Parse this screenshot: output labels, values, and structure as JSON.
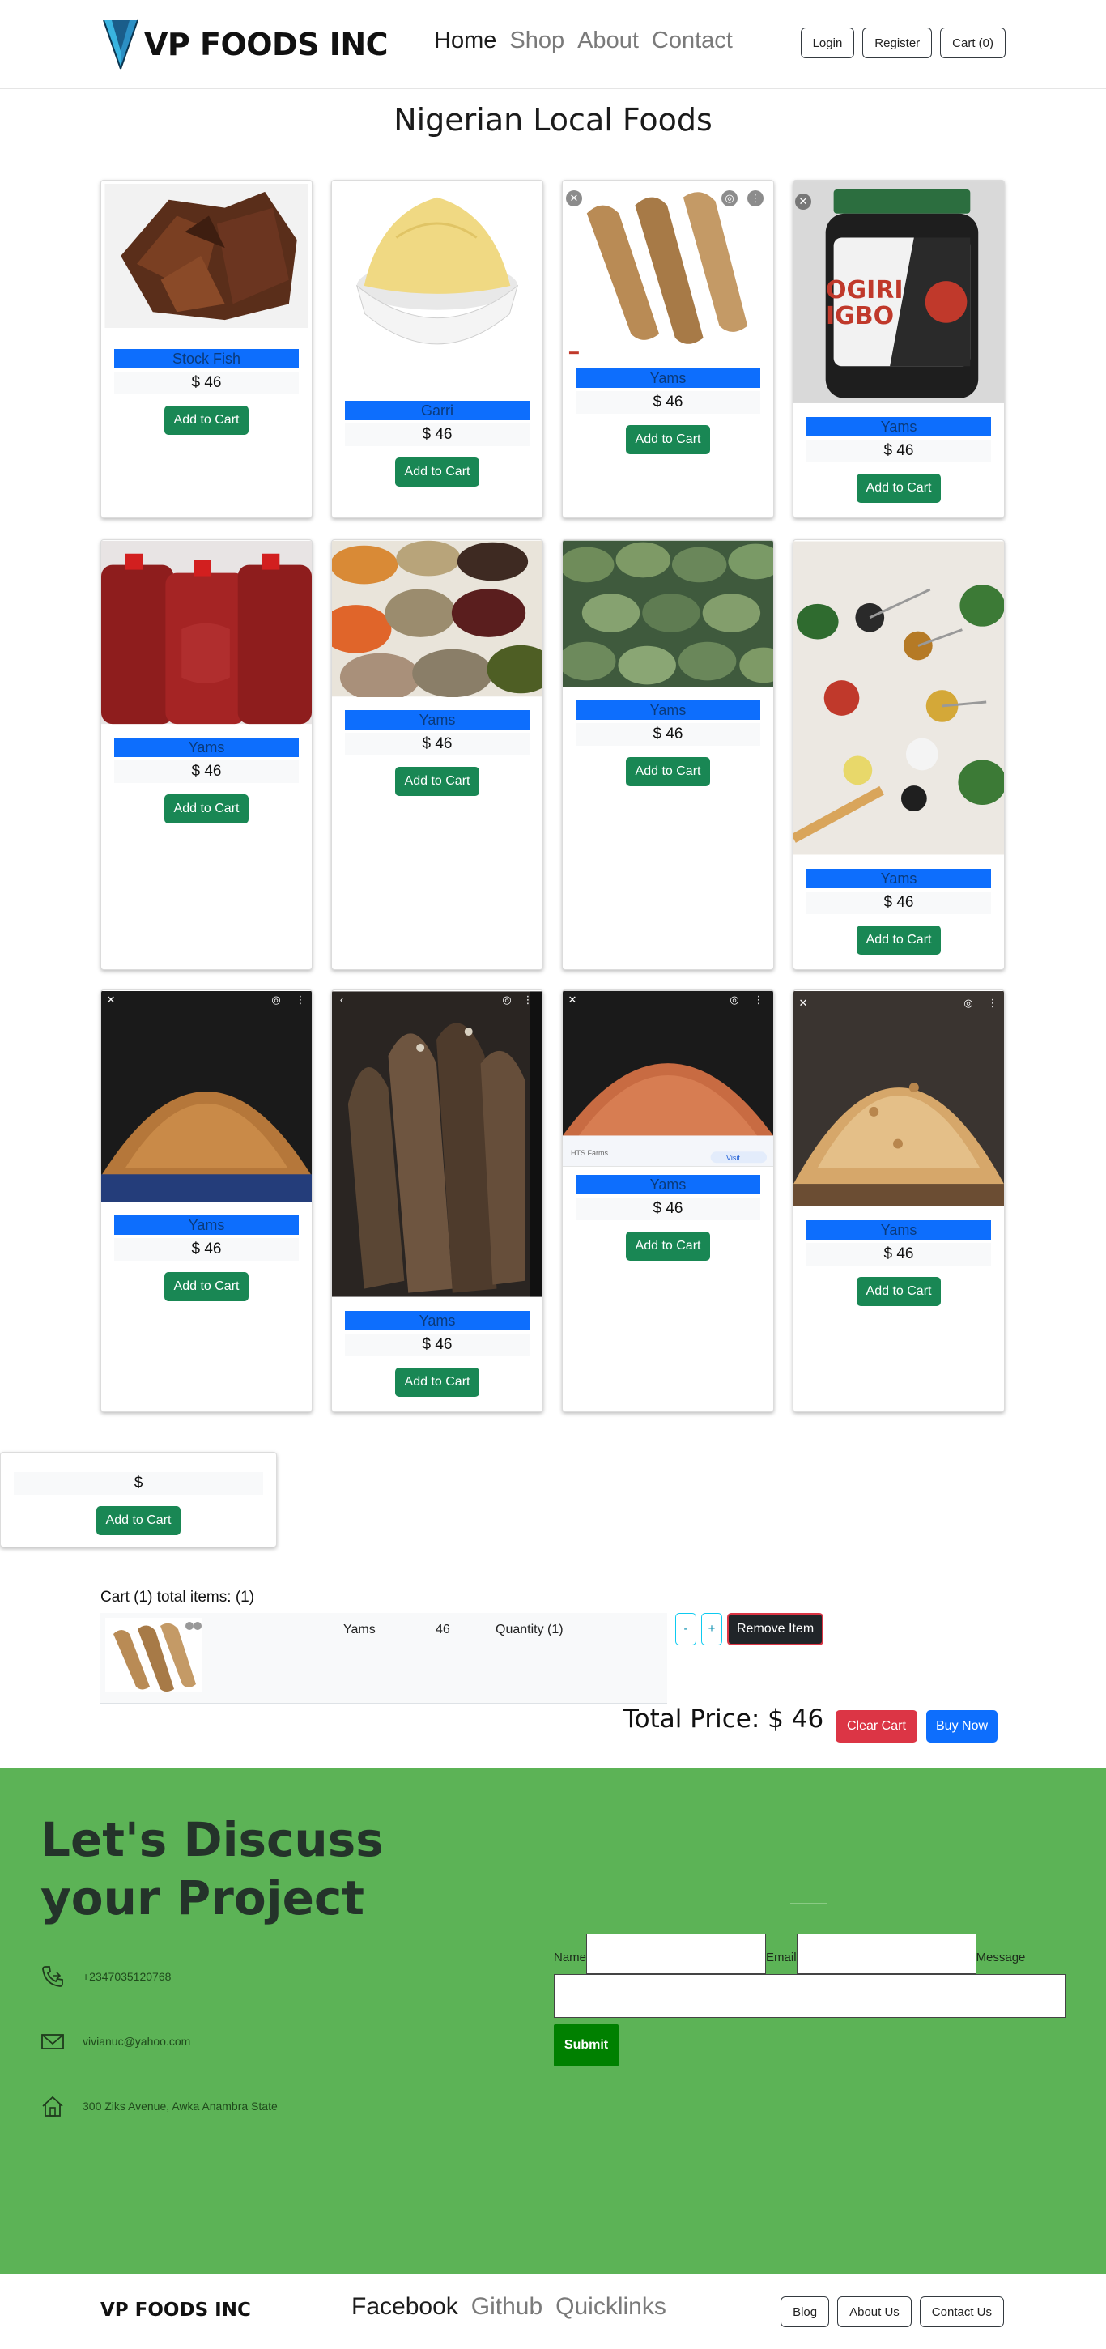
{
  "navbar": {
    "brand": "VP FOODS INC",
    "links": [
      "Home",
      "Shop",
      "About",
      "Contact"
    ],
    "actions": [
      "Login",
      "Register",
      "Cart (0)"
    ]
  },
  "page_title": "Nigerian Local Foods",
  "add_to_cart_label": "Add to Cart",
  "products": [
    {
      "name": "Stock Fish",
      "price": "$ 46",
      "image": "dried-fish-pile"
    },
    {
      "name": "Garri",
      "price": "$ 46",
      "image": "garri-bowl"
    },
    {
      "name": "Yams",
      "price": "$ 46",
      "image": "yam-tubers"
    },
    {
      "name": "Yams",
      "price": "$ 46",
      "image": "ogiri-igbo-jar"
    },
    {
      "name": "Yams",
      "price": "$ 46",
      "image": "palm-oil-gallons"
    },
    {
      "name": "Yams",
      "price": "$ 46",
      "image": "grain-sacks"
    },
    {
      "name": "Yams",
      "price": "$ 46",
      "image": "green-plantains"
    },
    {
      "name": "Yams",
      "price": "$ 46",
      "image": "spice-spoons"
    },
    {
      "name": "Yams",
      "price": "$ 46",
      "image": "grain-heap"
    },
    {
      "name": "Yams",
      "price": "$ 46",
      "image": "dried-catfish"
    },
    {
      "name": "Yams",
      "price": "$ 46",
      "image": "grain-heap-red"
    },
    {
      "name": "Yams",
      "price": "$ 46",
      "image": "nut-basket"
    }
  ],
  "jar_label": "OGIRI IGBO",
  "farm_badge": "HTS Farms",
  "visit_badge": "Visit",
  "lone_card": {
    "price": "$"
  },
  "cart": {
    "title": "Cart (1) total items: (1)",
    "item": {
      "name": "Yams",
      "price": "46",
      "quantity": "Quantity (1)",
      "image": "yam-tubers"
    },
    "minus": "-",
    "plus": "+",
    "remove": "Remove Item",
    "total": "Total Price: $ 46",
    "clear": "Clear Cart",
    "buy": "Buy Now"
  },
  "contact": {
    "heading": "Let's Discuss your Project",
    "phone": "+2347035120768",
    "email": "vivianuc@yahoo.com",
    "address": "300 Ziks Avenue, Awka Anambra State",
    "labels": {
      "name": "Name",
      "email": "Email",
      "message": "Message"
    },
    "submit": "Submit",
    "bg_color": "#5cb356"
  },
  "footer": {
    "brand": "VP FOODS INC",
    "links": [
      "Facebook",
      "Github",
      "Quicklinks"
    ],
    "actions": [
      "Blog",
      "About Us",
      "Contact Us"
    ]
  },
  "colors": {
    "primary": "#0d6efd",
    "success": "#198754",
    "danger": "#dc3545",
    "dark": "#212529"
  }
}
